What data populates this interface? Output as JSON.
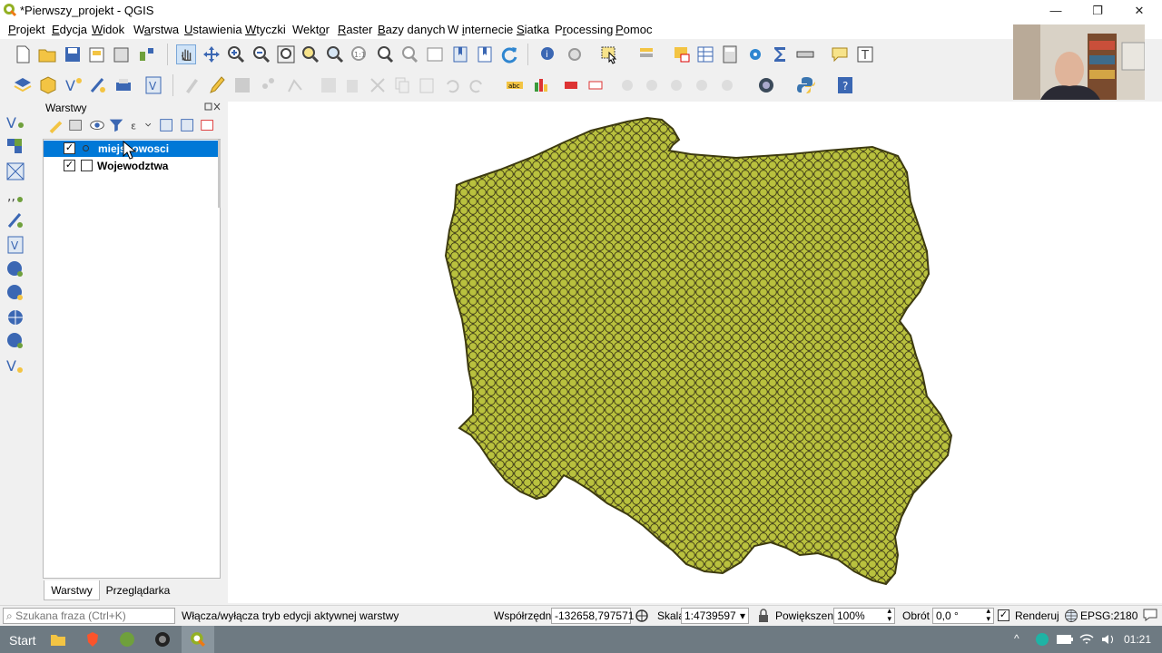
{
  "window": {
    "title": "*Pierwszy_projekt - QGIS",
    "controls": [
      "—",
      "❐",
      "✕"
    ]
  },
  "menu": [
    {
      "label": "Projekt",
      "accel": "P"
    },
    {
      "label": "Edycja",
      "accel": "E"
    },
    {
      "label": "Widok",
      "accel": "W"
    },
    {
      "label": "Warstwa",
      "accel": "a"
    },
    {
      "label": "Ustawienia",
      "accel": "U"
    },
    {
      "label": "Wtyczki",
      "accel": "W"
    },
    {
      "label": "Wektor",
      "accel": "o"
    },
    {
      "label": "Raster",
      "accel": "R"
    },
    {
      "label": "Bazy danych",
      "accel": "B"
    },
    {
      "label": "W internecie",
      "accel": "i"
    },
    {
      "label": "Siatka",
      "accel": "S"
    },
    {
      "label": "Processing",
      "accel": "r"
    },
    {
      "label": "Pomoc",
      "accel": "P"
    }
  ],
  "layers_panel": {
    "title": "Warstwy",
    "layers": [
      {
        "name": "miejscowosci",
        "checked": true,
        "selected": true,
        "color": "#b9c13e"
      },
      {
        "name": "Wojewodztwa",
        "checked": true,
        "selected": false
      }
    ],
    "tabs": [
      "Warstwy",
      "Przeglądarka"
    ],
    "active_tab": "Warstwy"
  },
  "status": {
    "search_placeholder": "Szukana fraza (Ctrl+K)",
    "message": "Włącza/wyłącza tryb edycji aktywnej warstwy",
    "coord_label": "Współrzędne",
    "coord_value": "-132658,797571",
    "scale_label": "Skala",
    "scale_value": "1:4739597",
    "magnifier_label": "Powiększenie",
    "magnifier_value": "100%",
    "rotation_label": "Obrót",
    "rotation_value": "0,0 °",
    "render_label": "Renderuj",
    "crs_label": "EPSG:2180"
  },
  "taskbar": {
    "start_label": "Start",
    "clock": "01:21"
  },
  "colors": {
    "selection": "#0078d7",
    "map_fill": "#b9c13e",
    "map_stroke": "#3d3a10",
    "taskbar": "#6e7a82"
  }
}
